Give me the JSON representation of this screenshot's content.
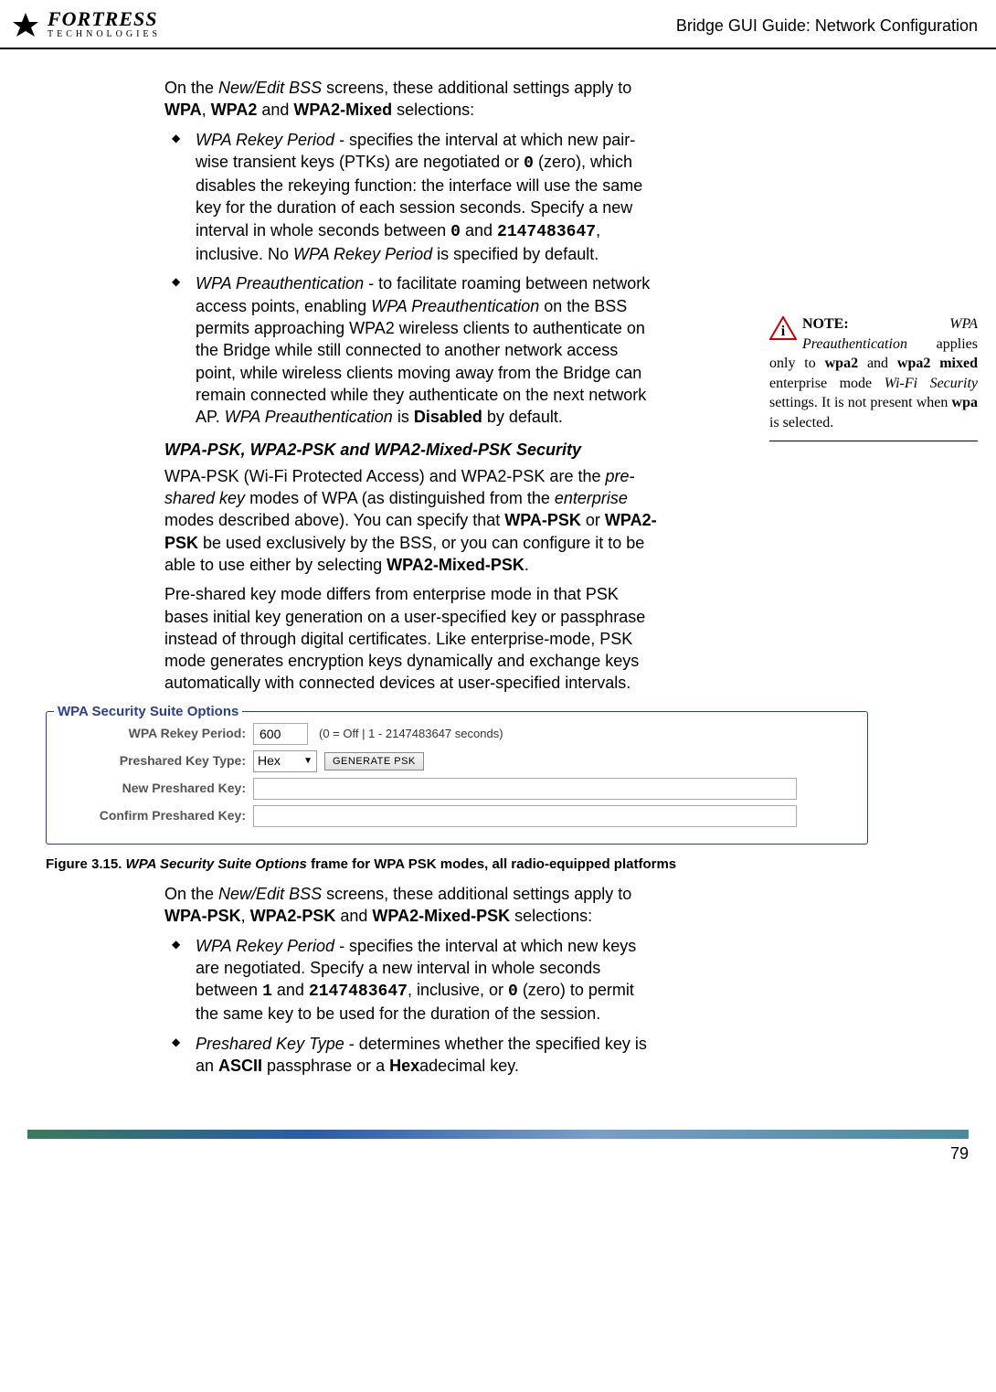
{
  "header": {
    "logo_name": "FORTRESS",
    "logo_sub": "TECHNOLOGIES",
    "title": "Bridge GUI Guide: Network Configuration"
  },
  "intro": {
    "p1_prefix": "On the ",
    "p1_italic": "New/Edit BSS",
    "p1_mid": " screens, these additional settings apply to ",
    "p1_c1": "WPA",
    "p1_c2": "WPA2",
    "p1_and": " and ",
    "p1_c3": "WPA2-Mixed",
    "p1_end": " selections:"
  },
  "bullets1": {
    "b1_label": "WPA Rekey Period",
    "b1_text1": " - specifies the interval at which new pair-wise transient keys (PTKs) are negotiated or ",
    "b1_zero": "0",
    "b1_text2": " (zero), which disables the rekeying function: the interface will use the same key for the duration of each session seconds. Specify a new interval in whole seconds between ",
    "b1_min": "0",
    "b1_and": " and ",
    "b1_max": "2147483647",
    "b1_text3": ", inclusive. No ",
    "b1_italic": "WPA Rekey Period",
    "b1_text4": " is specified by default.",
    "b2_label": "WPA Preauthentication",
    "b2_text1": " - to facilitate roaming between network access points, enabling ",
    "b2_italic1": "WPA Preauthentication",
    "b2_text2": " on the BSS permits approaching WPA2 wireless clients to authenticate on the Bridge while still connected to another network access point, while wireless clients moving away from the Bridge can remain connected while they authenticate on the next network AP. ",
    "b2_italic2": "WPA Preauthentication",
    "b2_text3": " is ",
    "b2_bold": "Disabled",
    "b2_text4": " by default."
  },
  "note": {
    "label": "NOTE:",
    "italic1": "WPA Preauthentication",
    "t1": " applies only to ",
    "b1": "wpa2",
    "t2": " and ",
    "b2": "wpa2 mixed",
    "t3": " enterprise mode ",
    "italic2": "Wi-Fi Security",
    "t4": " settings. It is not present when ",
    "b3": "wpa",
    "t5": " is selected."
  },
  "section2": {
    "heading": "WPA-PSK, WPA2-PSK and WPA2-Mixed-PSK Security",
    "p1_a": "WPA-PSK (Wi-Fi Protected Access) and WPA2-PSK are the ",
    "p1_i1": "pre-shared key",
    "p1_b": " modes of WPA (as distinguished from the ",
    "p1_i2": "enterprise",
    "p1_c": " modes described above). You can specify that ",
    "p1_m1": "WPA-PSK",
    "p1_d": " or ",
    "p1_m2": "WPA2-PSK",
    "p1_e": " be used exclusively by the BSS, or you can configure it to be able to use either by selecting ",
    "p1_m3": "WPA2-Mixed-PSK",
    "p1_f": ".",
    "p2": "Pre-shared key mode differs from enterprise mode in that PSK bases initial key generation on a user-specified key or passphrase instead of through digital certificates. Like enterprise-mode, PSK mode generates encryption keys dynamically and exchange keys automatically with connected devices at user-specified intervals."
  },
  "figure": {
    "legend": "WPA Security Suite Options",
    "row1_label": "WPA Rekey Period:",
    "row1_value": "600",
    "row1_hint": "(0 = Off | 1 - 2147483647 seconds)",
    "row2_label": "Preshared Key Type:",
    "row2_value": "Hex",
    "row2_button": "GENERATE PSK",
    "row3_label": "New Preshared Key:",
    "row4_label": "Confirm Preshared Key:",
    "caption_prefix": "Figure 3.15. ",
    "caption_italic": "WPA Security Suite Options",
    "caption_rest": " frame for WPA PSK modes, all radio-equipped platforms"
  },
  "intro2": {
    "p1_prefix": "On the ",
    "p1_italic": "New/Edit BSS",
    "p1_mid": " screens, these additional settings apply to ",
    "p1_c1": "WPA-PSK",
    "p1_c2": "WPA2-PSK",
    "p1_and": " and ",
    "p1_c3": "WPA2-Mixed-PSK",
    "p1_end": " selections:"
  },
  "bullets2": {
    "b1_label": "WPA Rekey Period",
    "b1_text1": " - specifies the interval at which new keys are negotiated. Specify a new interval in whole seconds between ",
    "b1_min": "1",
    "b1_and": " and ",
    "b1_max": "2147483647",
    "b1_text2": ", inclusive, or ",
    "b1_zero": "0",
    "b1_text3": " (zero) to permit the same key to be used for the duration of the session.",
    "b2_label": "Preshared Key Type",
    "b2_text1": " - determines whether the specified key is an ",
    "b2_m1": "ASCII",
    "b2_text2": " passphrase or a ",
    "b2_m2": "Hex",
    "b2_text3": "adecimal key."
  },
  "footer": {
    "page": "79"
  }
}
